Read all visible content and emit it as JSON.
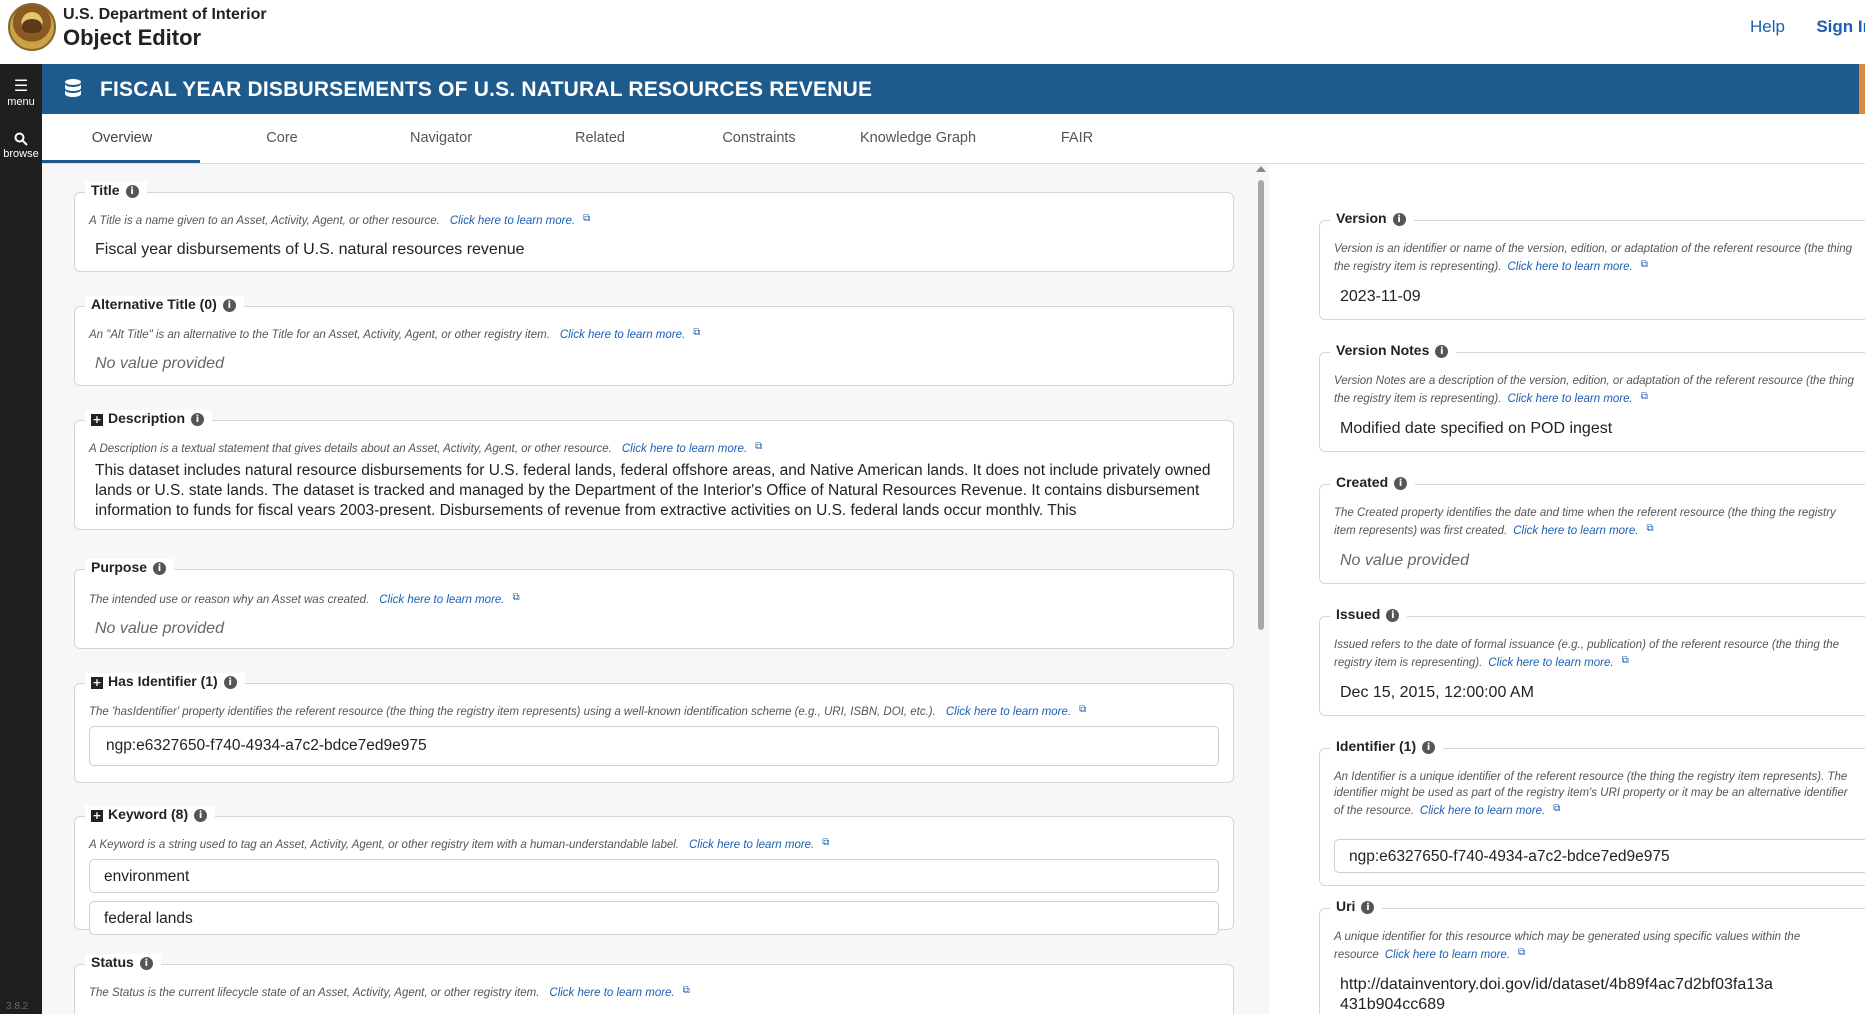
{
  "header": {
    "org": "U.S. Department of Interior",
    "app": "Object Editor",
    "help": "Help",
    "signin": "Sign In"
  },
  "rail": {
    "menu": "menu",
    "browse": "browse",
    "version": "3.8.2"
  },
  "page": {
    "title": "FISCAL YEAR DISBURSEMENTS OF U.S. NATURAL RESOURCES REVENUE"
  },
  "tabs": [
    "Overview",
    "Core",
    "Navigator",
    "Related",
    "Constraints",
    "Knowledge Graph",
    "FAIR"
  ],
  "learn_more": "Click here to learn more.",
  "left": {
    "title": {
      "label": "Title",
      "desc": "A Title is a name given to an Asset, Activity, Agent, or other resource.",
      "value": "Fiscal year disbursements of U.S. natural resources revenue"
    },
    "alt_title": {
      "label": "Alternative Title (0)",
      "desc": "An \"Alt Title\" is an alternative to the Title for an Asset, Activity, Agent, or other registry item.",
      "value": "No value provided"
    },
    "description": {
      "label": "Description",
      "desc": "A Description is a textual statement that gives details about an Asset, Activity, Agent, or other resource.",
      "value": "This dataset includes natural resource disbursements for U.S. federal lands, federal offshore areas, and Native American lands. It does not include privately owned lands or U.S. state lands. The dataset is tracked and managed by the Department of the Interior's Office of Natural Resources Revenue. It contains disbursement information to funds for fiscal years 2003-present. Disbursements of revenue from extractive activities on U.S. federal lands occur monthly. This"
    },
    "purpose": {
      "label": "Purpose",
      "desc": "The intended use or reason why an Asset was created.",
      "value": "No value provided"
    },
    "has_identifier": {
      "label": "Has Identifier (1)",
      "desc": "The 'hasIdentifier' property identifies the referent resource (the thing the registry item represents) using a well-known identification scheme (e.g., URI, ISBN, DOI, etc.).",
      "value": "ngp:e6327650-f740-4934-a7c2-bdce7ed9e975"
    },
    "keyword": {
      "label": "Keyword (8)",
      "desc": "A Keyword is a string used to tag an Asset, Activity, Agent, or other registry item with a human-understandable label.",
      "values": [
        "environment",
        "federal lands"
      ]
    },
    "status": {
      "label": "Status",
      "desc": "The Status is the current lifecycle state of an Asset, Activity, Agent, or other registry item."
    }
  },
  "right": {
    "version": {
      "label": "Version",
      "desc": "Version is an identifier or name of the version, edition, or adaptation of the referent resource (the thing the registry item is representing).",
      "value": "2023-11-09"
    },
    "version_notes": {
      "label": "Version Notes",
      "desc": "Version Notes are a description of the version, edition, or adaptation of the referent resource (the thing the registry item is representing).",
      "value": "Modified date specified on POD ingest"
    },
    "created": {
      "label": "Created",
      "desc": "The Created property identifies the date and time when the referent resource (the thing the registry item represents) was first created.",
      "value": "No value provided"
    },
    "issued": {
      "label": "Issued",
      "desc": "Issued refers to the date of formal issuance (e.g., publication) of the referent resource (the thing the registry item is representing).",
      "value": "Dec 15, 2015, 12:00:00 AM"
    },
    "identifier": {
      "label": "Identifier (1)",
      "desc": "An Identifier is a unique identifier of the referent resource (the thing the registry item represents). The identifier might be used as part of the registry item's URI property or it may be an alternative identifier of the resource.",
      "value": "ngp:e6327650-f740-4934-a7c2-bdce7ed9e975"
    },
    "uri": {
      "label": "Uri",
      "desc": "A unique identifier for this resource which may be generated using specific values within the resource",
      "value": "http://datainventory.doi.gov/id/dataset/4b89f4ac7d2bf03fa13a431b904cc689"
    }
  },
  "colors": {
    "titlebar": "#1e5b8c",
    "accent": "#d98a3c",
    "link": "#1a5fb4",
    "rail": "#1f1f1f"
  }
}
